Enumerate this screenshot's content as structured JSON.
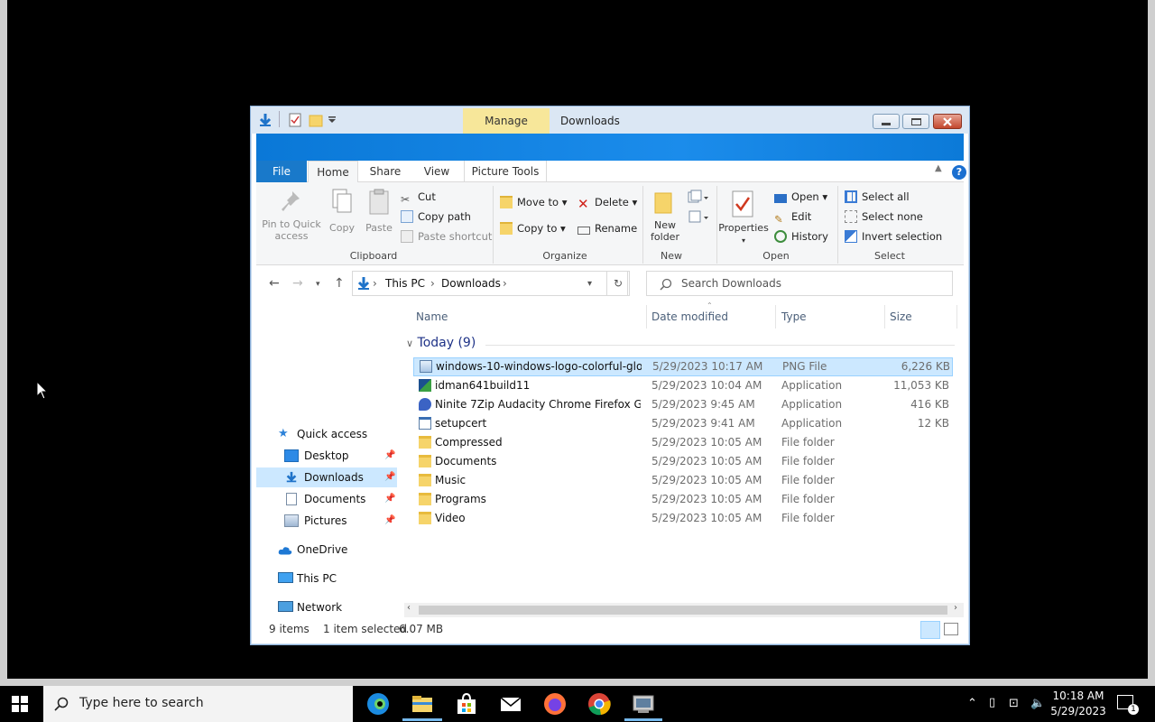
{
  "window": {
    "manage_tab": "Manage",
    "title": "Downloads"
  },
  "ribbon": {
    "tabs": [
      "File",
      "Home",
      "Share",
      "View",
      "Picture Tools"
    ],
    "clipboard": {
      "pin_label": "Pin to Quick access",
      "copy": "Copy",
      "paste": "Paste",
      "cut": "Cut",
      "copy_path": "Copy path",
      "paste_shortcut": "Paste shortcut",
      "group": "Clipboard"
    },
    "organize": {
      "move_to": "Move to",
      "copy_to": "Copy to",
      "delete": "Delete",
      "rename": "Rename",
      "group": "Organize"
    },
    "new": {
      "new_folder": "New folder",
      "group": "New"
    },
    "open": {
      "properties": "Properties",
      "open": "Open",
      "edit": "Edit",
      "history": "History",
      "group": "Open"
    },
    "select": {
      "select_all": "Select all",
      "select_none": "Select none",
      "invert": "Invert selection",
      "group": "Select"
    }
  },
  "address": {
    "crumbs": [
      "This PC",
      "Downloads"
    ],
    "search_placeholder": "Search Downloads"
  },
  "nav": {
    "quick_access": "Quick access",
    "desktop": "Desktop",
    "downloads": "Downloads",
    "documents": "Documents",
    "pictures": "Pictures",
    "onedrive": "OneDrive",
    "this_pc": "This PC",
    "network": "Network"
  },
  "columns": {
    "name": "Name",
    "date": "Date modified",
    "type": "Type",
    "size": "Size"
  },
  "group_header": "Today (9)",
  "files": [
    {
      "name": "windows-10-windows-logo-colorful-glo...",
      "date": "5/29/2023 10:17 AM",
      "type": "PNG File",
      "size": "6,226 KB"
    },
    {
      "name": "idman641build11",
      "date": "5/29/2023 10:04 AM",
      "type": "Application",
      "size": "11,053 KB"
    },
    {
      "name": "Ninite 7Zip Audacity Chrome Firefox Go...",
      "date": "5/29/2023 9:45 AM",
      "type": "Application",
      "size": "416 KB"
    },
    {
      "name": "setupcert",
      "date": "5/29/2023 9:41 AM",
      "type": "Application",
      "size": "12 KB"
    },
    {
      "name": "Compressed",
      "date": "5/29/2023 10:05 AM",
      "type": "File folder",
      "size": ""
    },
    {
      "name": "Documents",
      "date": "5/29/2023 10:05 AM",
      "type": "File folder",
      "size": ""
    },
    {
      "name": "Music",
      "date": "5/29/2023 10:05 AM",
      "type": "File folder",
      "size": ""
    },
    {
      "name": "Programs",
      "date": "5/29/2023 10:05 AM",
      "type": "File folder",
      "size": ""
    },
    {
      "name": "Video",
      "date": "5/29/2023 10:05 AM",
      "type": "File folder",
      "size": ""
    }
  ],
  "status": {
    "items": "9 items",
    "selected": "1 item selected",
    "size": "6.07 MB"
  },
  "taskbar": {
    "search_placeholder": "Type here to search",
    "time": "10:18 AM",
    "date": "5/29/2023",
    "notification_count": "1"
  },
  "icons": {
    "start": "windows-logo-icon",
    "edge": "edge-icon",
    "explorer": "file-explorer-icon",
    "store": "store-icon",
    "mail": "mail-icon",
    "firefox": "firefox-icon",
    "chrome": "chrome-icon"
  }
}
